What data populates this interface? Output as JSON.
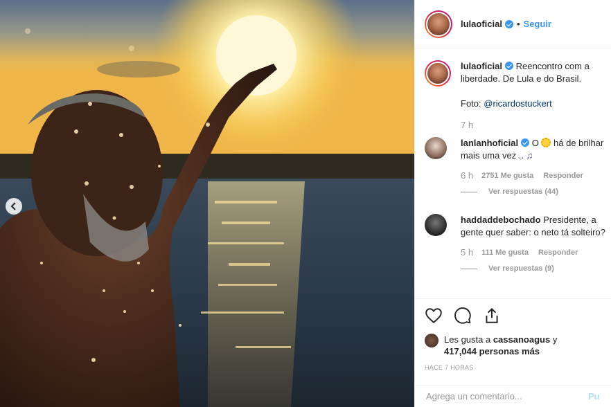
{
  "post": {
    "username": "lulaoficial",
    "follow_label": "Seguir",
    "dot": "•",
    "caption_text": "Reencontro com a liberdade. De Lula e do Brasil.",
    "caption_photo_prefix": "Foto: ",
    "caption_mention": "@ricardostuckert",
    "caption_time": "7 h"
  },
  "comments": [
    {
      "username": "lanlanhoficial",
      "text_before": " O ",
      "text_after": " há de brilhar mais uma vez .. ",
      "time": "6 h",
      "likes": "2751 Me gusta",
      "reply": "Responder",
      "view_replies": "Ver respuestas (44)"
    },
    {
      "username": "haddaddebochado",
      "text": " Presidente, a gente quer saber: o neto tá solteiro?",
      "time": "5 h",
      "likes": "111 Me gusta",
      "reply": "Responder",
      "view_replies": "Ver respuestas (9)"
    }
  ],
  "likes": {
    "prefix": "Les gusta a ",
    "user": "cassanoagus",
    "connector": " y",
    "others": "417,044 personas más"
  },
  "posted_ago": "HACE 7 HORAS",
  "comment_box": {
    "placeholder": "Agrega un comentario...",
    "publish_label": "Pu"
  },
  "colors": {
    "accent": "#3897f0",
    "sun": "#ffd23d"
  },
  "icons": [
    "chevron-left-icon",
    "verified-icon",
    "heart-icon",
    "comment-icon",
    "share-icon"
  ]
}
